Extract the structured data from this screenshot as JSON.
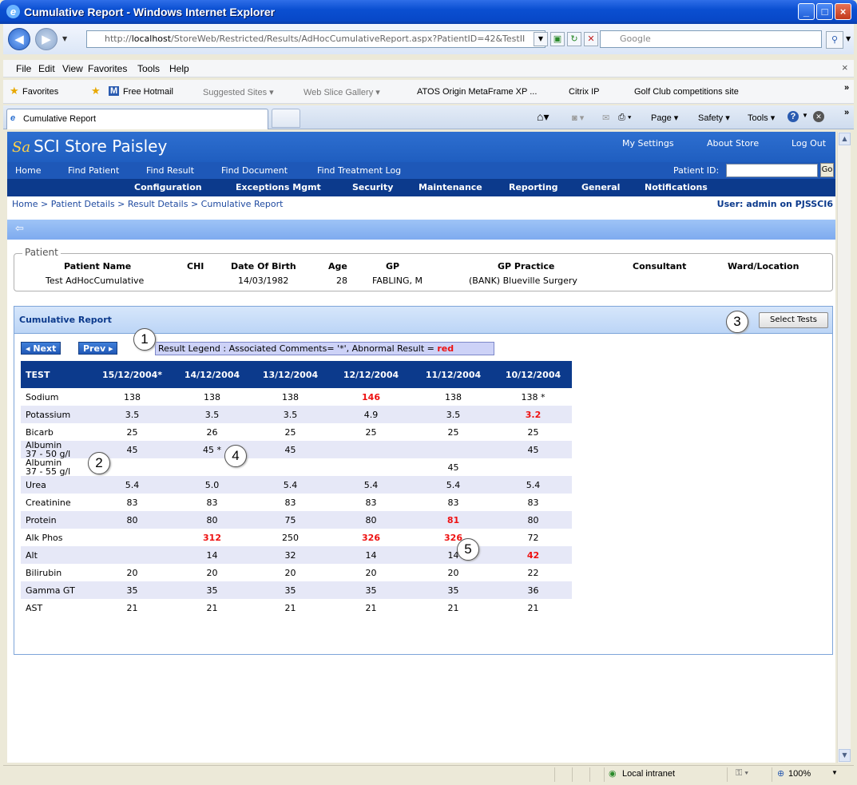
{
  "window": {
    "title": "Cumulative Report - Windows Internet Explorer"
  },
  "addressbar": {
    "url_prefix": "http://",
    "url_host": "localhost",
    "url_rest": "/StoreWeb/Restricted/Results/AdHocCumulativeReport.aspx?PatientID=42&TestII",
    "search_placeholder": "Google"
  },
  "menu": [
    "File",
    "Edit",
    "View",
    "Favorites",
    "Tools",
    "Help"
  ],
  "favorites": {
    "label": "Favorites",
    "items": [
      "Free Hotmail",
      "Suggested Sites ▾",
      "Web Slice Gallery ▾",
      "ATOS Origin MetaFrame XP ...",
      "Citrix IP",
      "Golf Club competitions site"
    ]
  },
  "tab": {
    "label": "Cumulative Report"
  },
  "commandbar": {
    "page": "Page ▾",
    "safety": "Safety ▾",
    "tools": "Tools ▾"
  },
  "site": {
    "name": "SCI Store Paisley",
    "logo_mark": "Sa",
    "top_links": [
      "My Settings",
      "About Store",
      "Log Out"
    ],
    "nav1": [
      "Home",
      "Find Patient",
      "Find Result",
      "Find Document",
      "Find Treatment Log"
    ],
    "patient_id_label": "Patient ID:",
    "go": "Go",
    "nav2": [
      "Configuration",
      "Exceptions Mgmt",
      "Security",
      "Maintenance",
      "Reporting",
      "General",
      "Notifications"
    ],
    "breadcrumb": "Home > Patient Details > Result Details > Cumulative Report",
    "user": "User: admin on PJSSCI6",
    "back_arrow": "⇦"
  },
  "patient": {
    "legend": "Patient",
    "headers": [
      "Patient Name",
      "CHI",
      "Date Of Birth",
      "Age",
      "GP",
      "GP Practice",
      "Consultant",
      "Ward/Location"
    ],
    "values": [
      "Test AdHocCumulative",
      "",
      "14/03/1982",
      "28",
      "FABLING, M",
      "(BANK) Blueville Surgery",
      "",
      ""
    ]
  },
  "cumulative": {
    "title": "Cumulative Report",
    "select_tests": "Select Tests",
    "next": "◂ Next",
    "prev": "Prev ▸",
    "legend_text": "Result Legend : Associated Comments= '*', Abnormal Result = ",
    "legend_red": "red",
    "columns": [
      "TEST",
      "15/12/2004*",
      "14/12/2004",
      "13/12/2004",
      "12/12/2004",
      "11/12/2004",
      "10/12/2004"
    ],
    "rows": [
      {
        "name": [
          "Sodium"
        ],
        "cells": [
          {
            "v": "138"
          },
          {
            "v": "138"
          },
          {
            "v": "138"
          },
          {
            "v": "146",
            "abn": true
          },
          {
            "v": "138"
          },
          {
            "v": "138 *"
          }
        ]
      },
      {
        "name": [
          "Potassium"
        ],
        "cells": [
          {
            "v": "3.5"
          },
          {
            "v": "3.5"
          },
          {
            "v": "3.5"
          },
          {
            "v": "4.9"
          },
          {
            "v": "3.5"
          },
          {
            "v": "3.2",
            "abn": true
          }
        ]
      },
      {
        "name": [
          "Bicarb"
        ],
        "cells": [
          {
            "v": "25"
          },
          {
            "v": "26"
          },
          {
            "v": "25"
          },
          {
            "v": "25"
          },
          {
            "v": "25"
          },
          {
            "v": "25"
          }
        ]
      },
      {
        "name": [
          "Albumin",
          "37 - 50 g/l"
        ],
        "cells": [
          {
            "v": "45"
          },
          {
            "v": "45 *"
          },
          {
            "v": "45"
          },
          {
            "v": ""
          },
          {
            "v": ""
          },
          {
            "v": "45"
          }
        ]
      },
      {
        "name": [
          "Albumin",
          "37 - 55 g/l"
        ],
        "cells": [
          {
            "v": ""
          },
          {
            "v": ""
          },
          {
            "v": ""
          },
          {
            "v": ""
          },
          {
            "v": "45"
          },
          {
            "v": ""
          }
        ]
      },
      {
        "name": [
          "Urea"
        ],
        "cells": [
          {
            "v": "5.4"
          },
          {
            "v": "5.0"
          },
          {
            "v": "5.4"
          },
          {
            "v": "5.4"
          },
          {
            "v": "5.4"
          },
          {
            "v": "5.4"
          }
        ]
      },
      {
        "name": [
          "Creatinine"
        ],
        "cells": [
          {
            "v": "83"
          },
          {
            "v": "83"
          },
          {
            "v": "83"
          },
          {
            "v": "83"
          },
          {
            "v": "83"
          },
          {
            "v": "83"
          }
        ]
      },
      {
        "name": [
          "Protein"
        ],
        "cells": [
          {
            "v": "80"
          },
          {
            "v": "80"
          },
          {
            "v": "75"
          },
          {
            "v": "80"
          },
          {
            "v": "81",
            "abn": true
          },
          {
            "v": "80"
          }
        ]
      },
      {
        "name": [
          "Alk Phos"
        ],
        "cells": [
          {
            "v": ""
          },
          {
            "v": "312",
            "abn": true
          },
          {
            "v": "250"
          },
          {
            "v": "326",
            "abn": true
          },
          {
            "v": "326",
            "abn": true
          },
          {
            "v": "72"
          }
        ]
      },
      {
        "name": [
          "Alt"
        ],
        "cells": [
          {
            "v": ""
          },
          {
            "v": "14"
          },
          {
            "v": "32"
          },
          {
            "v": "14"
          },
          {
            "v": "14"
          },
          {
            "v": "42",
            "abn": true
          }
        ]
      },
      {
        "name": [
          "Bilirubin"
        ],
        "cells": [
          {
            "v": "20"
          },
          {
            "v": "20"
          },
          {
            "v": "20"
          },
          {
            "v": "20"
          },
          {
            "v": "20"
          },
          {
            "v": "22"
          }
        ]
      },
      {
        "name": [
          "Gamma GT"
        ],
        "cells": [
          {
            "v": "35"
          },
          {
            "v": "35"
          },
          {
            "v": "35"
          },
          {
            "v": "35"
          },
          {
            "v": "35"
          },
          {
            "v": "36"
          }
        ]
      },
      {
        "name": [
          "AST"
        ],
        "cells": [
          {
            "v": "21"
          },
          {
            "v": "21"
          },
          {
            "v": "21"
          },
          {
            "v": "21"
          },
          {
            "v": "21"
          },
          {
            "v": "21"
          }
        ]
      }
    ]
  },
  "callouts": [
    "1",
    "2",
    "3",
    "4",
    "5"
  ],
  "statusbar": {
    "zone": "Local intranet",
    "zoom": "100%"
  },
  "colors": {
    "header_blue": "#0c3a8c",
    "nav_blue": "#1e58b8",
    "abnormal_red": "#e11111",
    "row_alt": "#e6e8f7"
  }
}
